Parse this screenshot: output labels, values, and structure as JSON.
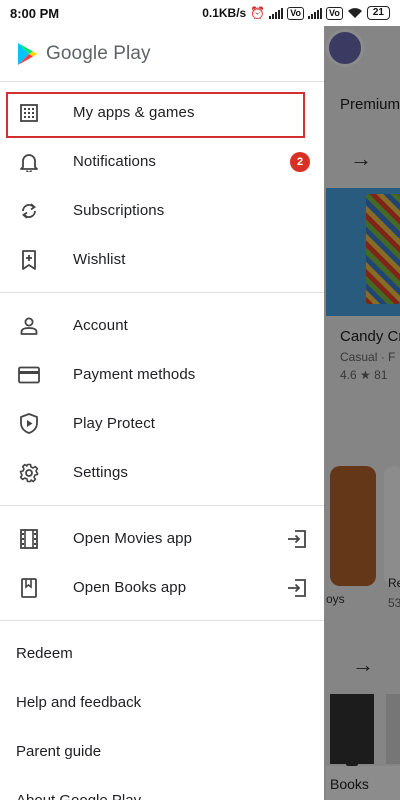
{
  "status_bar": {
    "time": "8:00 PM",
    "speed": "0.1KB/s",
    "vo1": "Vo",
    "vo2": "Vo",
    "battery": "21"
  },
  "background": {
    "tab_label": "Premium",
    "game_title": "Candy Cr",
    "game_genre": "Casual · F",
    "game_rating": "4.6 ★  81",
    "card_a_snippet": "oys",
    "card_b_title": "Re",
    "card_b_sub": "53",
    "bottom_nav_books": "Books"
  },
  "drawer": {
    "brand": "Google Play",
    "primary_items": [
      {
        "label": "My apps & games",
        "icon": "grid-icon"
      },
      {
        "label": "Notifications",
        "icon": "bell-icon",
        "badge": "2"
      },
      {
        "label": "Subscriptions",
        "icon": "refresh-icon"
      },
      {
        "label": "Wishlist",
        "icon": "bookmark-add-icon"
      }
    ],
    "account_items": [
      {
        "label": "Account",
        "icon": "person-icon"
      },
      {
        "label": "Payment methods",
        "icon": "credit-card-icon"
      },
      {
        "label": "Play Protect",
        "icon": "shield-play-icon"
      },
      {
        "label": "Settings",
        "icon": "gear-icon"
      }
    ],
    "app_items": [
      {
        "label": "Open Movies app",
        "icon": "film-icon"
      },
      {
        "label": "Open Books app",
        "icon": "book-icon"
      }
    ],
    "text_items": [
      {
        "label": "Redeem"
      },
      {
        "label": "Help and feedback"
      },
      {
        "label": "Parent guide"
      },
      {
        "label": "About Google Play"
      }
    ]
  },
  "colors": {
    "highlight": "#d32f2f",
    "badge": "#d93025",
    "text": "#202124"
  }
}
